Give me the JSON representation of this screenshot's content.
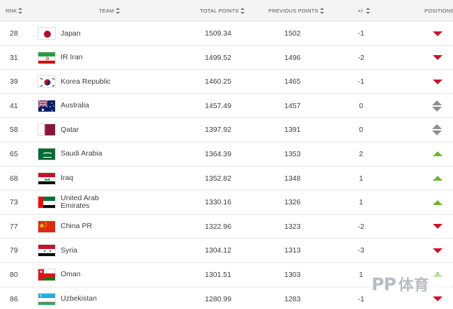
{
  "header": {
    "rank": "RNK",
    "team": "TEAM",
    "total_points": "TOTAL POINTS",
    "previous_points": "PREVIOUS POINTS",
    "diff": "+/-",
    "positions": "POSITIONS"
  },
  "rows": [
    {
      "rank": "28",
      "team": "Japan",
      "flag": "japan-flag",
      "total": "1509.34",
      "previous": "1502",
      "diff": "-1",
      "trend": "down"
    },
    {
      "rank": "31",
      "team": "IR Iran",
      "flag": "iran-flag",
      "total": "1499.52",
      "previous": "1496",
      "diff": "-2",
      "trend": "down"
    },
    {
      "rank": "39",
      "team": "Korea Republic",
      "flag": "korea-flag",
      "total": "1460.25",
      "previous": "1465",
      "diff": "-1",
      "trend": "down"
    },
    {
      "rank": "41",
      "team": "Australia",
      "flag": "australia-flag",
      "total": "1457.49",
      "previous": "1457",
      "diff": "0",
      "trend": "same"
    },
    {
      "rank": "58",
      "team": "Qatar",
      "flag": "qatar-flag",
      "total": "1397.92",
      "previous": "1391",
      "diff": "0",
      "trend": "same"
    },
    {
      "rank": "65",
      "team": "Saudi Arabia",
      "flag": "saudi-arabia-flag",
      "total": "1364.39",
      "previous": "1353",
      "diff": "2",
      "trend": "up"
    },
    {
      "rank": "68",
      "team": "Iraq",
      "flag": "iraq-flag",
      "total": "1352.82",
      "previous": "1348",
      "diff": "1",
      "trend": "up"
    },
    {
      "rank": "73",
      "team": "United Arab Emirates",
      "flag": "uae-flag",
      "total": "1330.16",
      "previous": "1326",
      "diff": "1",
      "trend": "up"
    },
    {
      "rank": "77",
      "team": "China PR",
      "flag": "china-flag",
      "total": "1322.96",
      "previous": "1323",
      "diff": "-2",
      "trend": "down"
    },
    {
      "rank": "79",
      "team": "Syria",
      "flag": "syria-flag",
      "total": "1304.12",
      "previous": "1313",
      "diff": "-3",
      "trend": "down"
    },
    {
      "rank": "80",
      "team": "Oman",
      "flag": "oman-flag",
      "total": "1301.51",
      "previous": "1303",
      "diff": "1",
      "trend": "up"
    },
    {
      "rank": "86",
      "team": "Uzbekistan",
      "flag": "uzbekistan-flag",
      "total": "1280.99",
      "previous": "1283",
      "diff": "-1",
      "trend": "down"
    }
  ],
  "colors": {
    "down": "#d0112b",
    "up": "#6ab72c",
    "same": "#8f8f8f"
  },
  "watermark": {
    "logo": "PP",
    "text": "体育"
  }
}
